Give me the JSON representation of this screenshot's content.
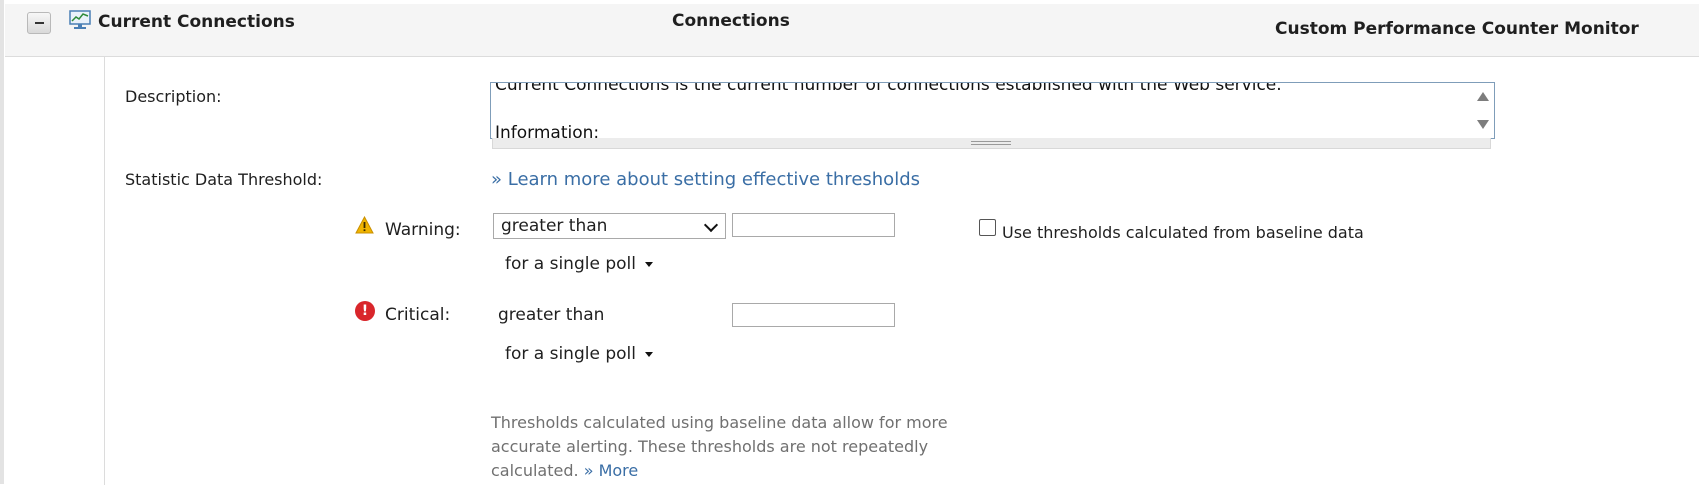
{
  "header": {
    "title": "Current Connections",
    "connections_label": "Connections",
    "monitor_type": "Custom Performance Counter Monitor"
  },
  "description": {
    "label": "Description:",
    "text": "Current Connections is the current number of connections established with the Web service.\n\nInformation:"
  },
  "threshold": {
    "label": "Statistic Data Threshold:",
    "learn_more_link": "» Learn more about setting effective thresholds",
    "warning": {
      "label": "Warning:",
      "operator": "greater than",
      "value": "",
      "poll": "for  a single poll"
    },
    "critical": {
      "label": "Critical:",
      "operator": "greater than",
      "value": "",
      "poll": "for  a single poll"
    },
    "baseline_checkbox_label": "Use thresholds calculated from baseline data",
    "baseline_checked": false,
    "help_text": "Thresholds calculated using baseline data allow for more accurate alerting. These thresholds are not repeatedly calculated.",
    "help_more_link": "» More"
  },
  "colors": {
    "link": "#3a6ea5",
    "warning": "#f0b400",
    "critical": "#d9262b"
  }
}
